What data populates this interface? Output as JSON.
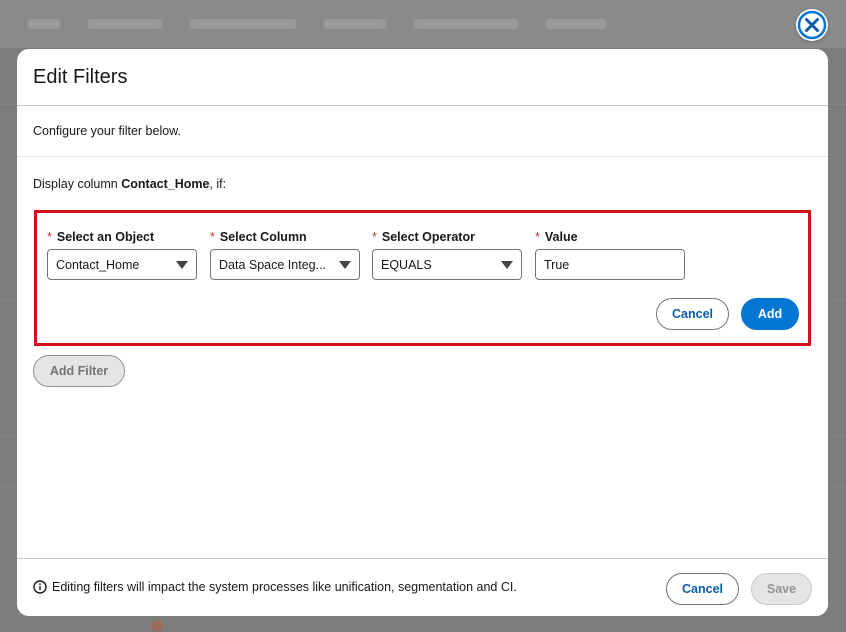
{
  "colors": {
    "brand": "#0176d3",
    "link": "#0b5cab",
    "required": "#c23934",
    "highlight_border": "#d4111e",
    "overlay": "#7d7d7d"
  },
  "close_icon": "close-icon",
  "modal": {
    "title": "Edit Filters",
    "subtitle": "Configure your filter below.",
    "display_prefix": "Display column ",
    "display_column": "Contact_Home",
    "display_suffix": ", if:"
  },
  "filter": {
    "required_mark": "*",
    "object": {
      "label": "Select an Object",
      "value": "Contact_Home"
    },
    "column": {
      "label": "Select Column",
      "value": "Data Space Integ..."
    },
    "operator": {
      "label": "Select Operator",
      "value": "EQUALS"
    },
    "value": {
      "label": "Value",
      "value": "True"
    },
    "cancel_label": "Cancel",
    "add_label": "Add"
  },
  "add_filter_label": "Add Filter",
  "footer": {
    "info_icon": "info-icon",
    "note": "Editing filters will impact the system processes like unification, segmentation and CI.",
    "cancel_label": "Cancel",
    "save_label": "Save"
  }
}
